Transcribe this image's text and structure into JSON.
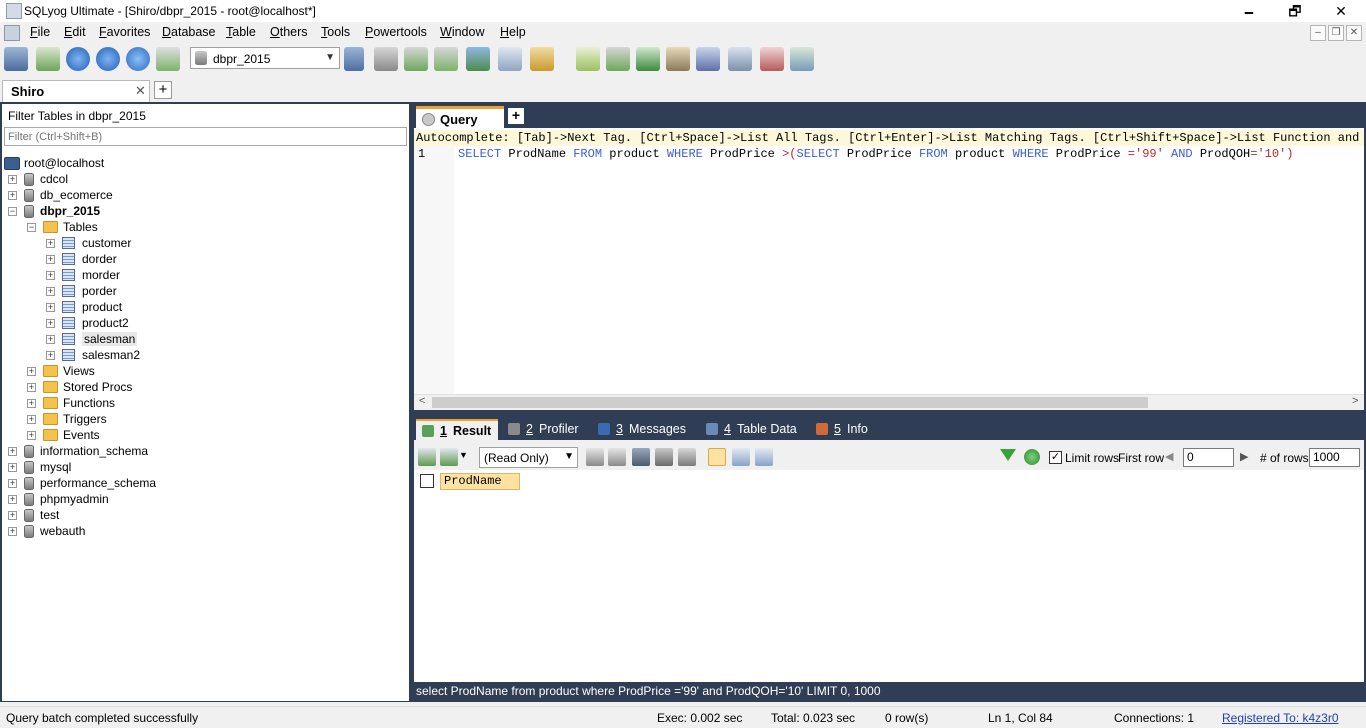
{
  "window": {
    "title": "SQLyog Ultimate - [Shiro/dbpr_2015 - root@localhost*]",
    "minimize": "🗕",
    "maximize": "🗗",
    "close": "✕"
  },
  "menu": [
    "File",
    "Edit",
    "Favorites",
    "Database",
    "Table",
    "Others",
    "Tools",
    "Powertools",
    "Window",
    "Help"
  ],
  "mdi": {
    "minimize": "–",
    "restore": "❐",
    "close": "✕"
  },
  "toolbar": {
    "db_select": "dbpr_2015",
    "arrow": "▼"
  },
  "connection_tab": {
    "label": "Shiro",
    "close": "✕",
    "add": "+"
  },
  "object_browser": {
    "filter_label": "Filter Tables in dbpr_2015",
    "filter_placeholder": "Filter (Ctrl+Shift+B)",
    "root": "root@localhost",
    "databases_before": [
      "cdcol",
      "db_ecomerce"
    ],
    "current_db": "dbpr_2015",
    "tables_folder": "Tables",
    "tables": [
      "customer",
      "dorder",
      "morder",
      "porder",
      "product",
      "product2",
      "salesman",
      "salesman2"
    ],
    "folders": [
      "Views",
      "Stored Procs",
      "Functions",
      "Triggers",
      "Events"
    ],
    "databases_after": [
      "information_schema",
      "mysql",
      "performance_schema",
      "phpmyadmin",
      "test",
      "webauth"
    ],
    "expand": "+",
    "collapse": "−"
  },
  "query_tab": {
    "label": "Query",
    "add": "+"
  },
  "editor": {
    "autocomplete": "Autocomplete: [Tab]->Next Tag. [Ctrl+Space]->List All Tags. [Ctrl+Enter]->List Matching Tags. [Ctrl+Shift+Space]->List Function and Routine Parameters.",
    "line_number": "1",
    "tokens": [
      {
        "t": "SELECT",
        "c": "kw"
      },
      {
        "t": " ProdName ",
        "c": ""
      },
      {
        "t": "FROM",
        "c": "kw"
      },
      {
        "t": " product ",
        "c": ""
      },
      {
        "t": "WHERE",
        "c": "kw"
      },
      {
        "t": " ProdPrice ",
        "c": ""
      },
      {
        "t": ">(",
        "c": "op"
      },
      {
        "t": "SELECT",
        "c": "kw"
      },
      {
        "t": " ProdPrice ",
        "c": ""
      },
      {
        "t": "FROM",
        "c": "kw"
      },
      {
        "t": " product ",
        "c": ""
      },
      {
        "t": "WHERE",
        "c": "kw"
      },
      {
        "t": " ProdPrice ",
        "c": ""
      },
      {
        "t": "=",
        "c": "op"
      },
      {
        "t": "'99'",
        "c": "str"
      },
      {
        "t": " ",
        "c": ""
      },
      {
        "t": "AND",
        "c": "kw"
      },
      {
        "t": " ProdQOH",
        "c": ""
      },
      {
        "t": "=",
        "c": "op"
      },
      {
        "t": "'10'",
        "c": "str"
      },
      {
        "t": ")",
        "c": "op"
      }
    ],
    "scroll_left": "<",
    "scroll_right": ">"
  },
  "result_tabs": [
    {
      "num": "1",
      "label": "Result"
    },
    {
      "num": "2",
      "label": "Profiler"
    },
    {
      "num": "3",
      "label": "Messages"
    },
    {
      "num": "4",
      "label": "Table Data"
    },
    {
      "num": "5",
      "label": "Info"
    }
  ],
  "result_toolbar": {
    "mode": "(Read Only)",
    "arrow": "▼",
    "limit_rows_label": "Limit rows",
    "limit_checked": "✓",
    "first_row_label": "First row",
    "first_row_value": "0",
    "num_rows_label": "# of rows",
    "num_rows_value": "1000",
    "prev": "◀",
    "next": "▶"
  },
  "grid": {
    "columns": [
      "ProdName"
    ]
  },
  "sql_status": "select ProdName from product where ProdPrice ='99' and ProdQOH='10' LIMIT 0, 1000",
  "statusbar": {
    "message": "Query batch completed successfully",
    "exec": "Exec: 0.002 sec",
    "total": "Total: 0.023 sec",
    "rows": "0 row(s)",
    "position": "Ln 1, Col 84",
    "connections": "Connections: 1",
    "registered": "Registered To: k4z3r0"
  }
}
